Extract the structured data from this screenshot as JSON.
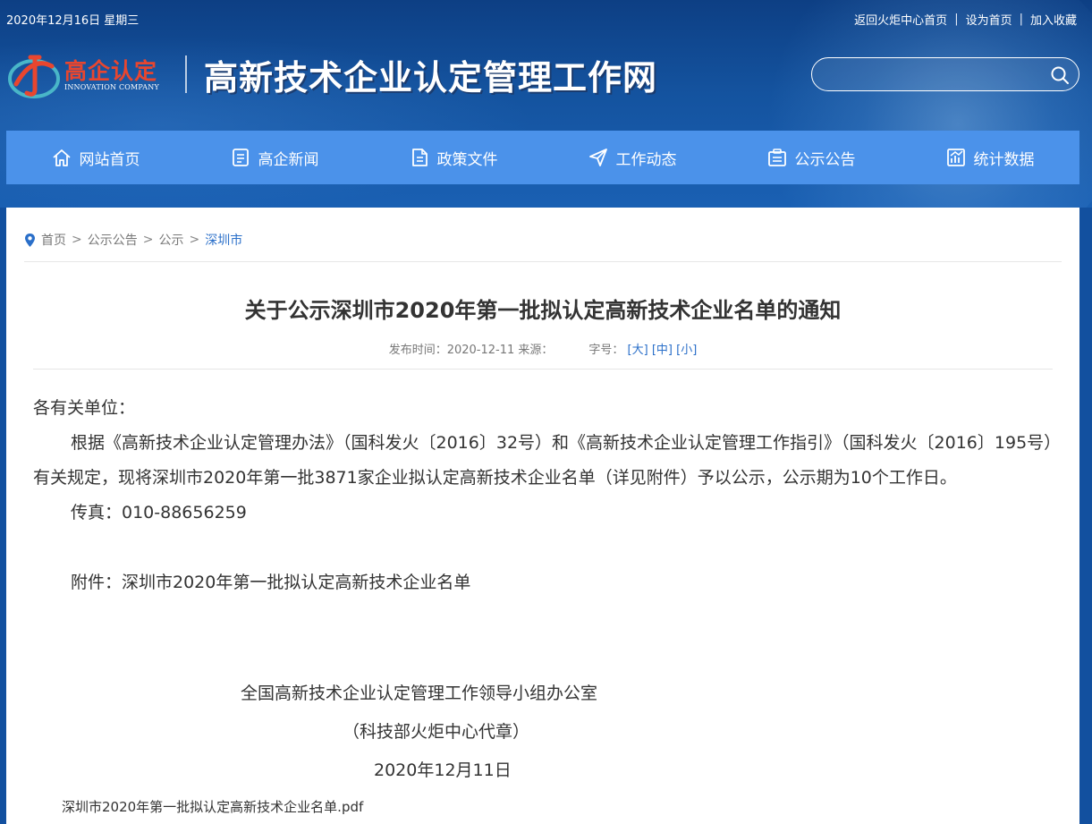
{
  "topbar": {
    "date": "2020年12月16日 星期三",
    "links": [
      "返回火炬中心首页",
      "设为首页",
      "加入收藏"
    ],
    "separator": "|"
  },
  "logo": {
    "cn": "高企认定",
    "en": "INNOVATION COMPANY"
  },
  "site_title": "高新技术企业认定管理工作网",
  "search": {
    "placeholder": "",
    "value": ""
  },
  "nav": [
    {
      "label": "网站首页",
      "icon": "home-icon"
    },
    {
      "label": "高企新闻",
      "icon": "news-icon"
    },
    {
      "label": "政策文件",
      "icon": "document-icon"
    },
    {
      "label": "工作动态",
      "icon": "paper-plane-icon"
    },
    {
      "label": "公示公告",
      "icon": "notice-icon"
    },
    {
      "label": "统计数据",
      "icon": "chart-icon"
    }
  ],
  "breadcrumb": {
    "items": [
      "首页",
      "公示公告",
      "公示"
    ],
    "current": "深圳市",
    "separator": ">"
  },
  "article": {
    "title": "关于公示深圳市2020年第一批拟认定高新技术企业名单的通知",
    "meta_time": "发布时间：2020-12-11 来源：",
    "meta_fontsize_label": "字号：",
    "font_sizes": [
      "[大]",
      "[中]",
      "[小]"
    ],
    "salutation": "各有关单位：",
    "paragraph": "根据《高新技术企业认定管理办法》（国科发火〔2016〕32号）和《高新技术企业认定管理工作指引》（国科发火〔2016〕195号）有关规定，现将深圳市2020年第一批3871家企业拟认定高新技术企业名单（详见附件）予以公示，公示期为10个工作日。",
    "fax": "传真：010-88656259",
    "attachment_line": "附件：深圳市2020年第一批拟认定高新技术企业名单",
    "sign_org": "全国高新技术企业认定管理工作领导小组办公室",
    "sign_stamp": "（科技部火炬中心代章）",
    "sign_date": "2020年12月11日",
    "attachment_file": "深圳市2020年第一批拟认定高新技术企业名单.pdf"
  },
  "colors": {
    "header_blue": "#14539f",
    "nav_blue": "#4b92ea",
    "logo_red": "#e8462f",
    "link_blue": "#2a6fc9"
  }
}
